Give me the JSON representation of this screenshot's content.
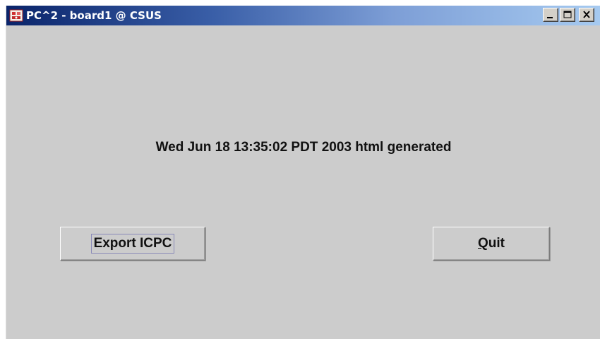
{
  "window": {
    "title": "PC^2 - board1 @ CSUS",
    "app_icon": "pc2-app-icon",
    "controls": {
      "minimize_icon": "minimize-icon",
      "maximize_icon": "maximize-icon",
      "close_icon": "close-icon"
    }
  },
  "main": {
    "status_text": "Wed Jun 18 13:35:02 PDT 2003 html generated",
    "export_button_label": "Export ICPC",
    "quit_button": {
      "mnemonic": "Q",
      "rest": "uit"
    }
  },
  "colors": {
    "window_background": "#cccccc",
    "titlebar_start": "#0a246a",
    "titlebar_end": "#a6caf0",
    "title_text": "#ffffff"
  }
}
